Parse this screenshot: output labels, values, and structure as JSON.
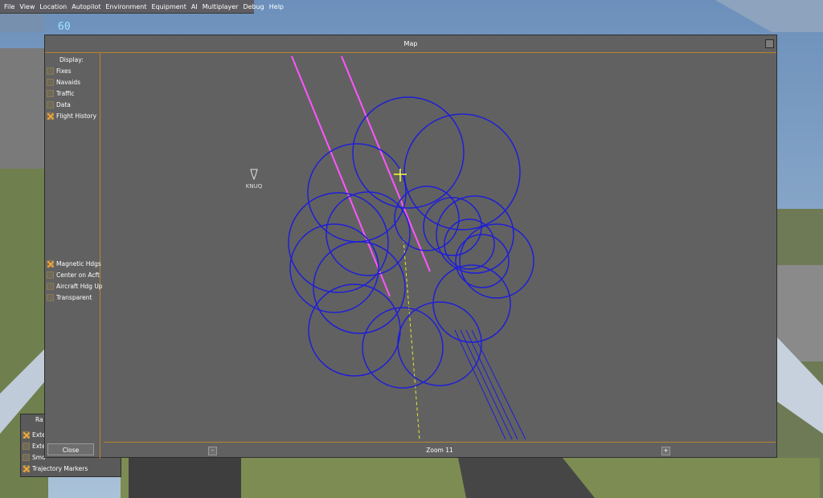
{
  "menubar": {
    "items": [
      "File",
      "View",
      "Location",
      "Autopilot",
      "Environment",
      "Equipment",
      "AI",
      "Multiplayer",
      "Debug",
      "Help"
    ]
  },
  "hud": {
    "speed_value": "60"
  },
  "map_dialog": {
    "title": "Map",
    "display_label": "Display:",
    "display_options": [
      {
        "label": "Fixes",
        "checked": false
      },
      {
        "label": "Navaids",
        "checked": false
      },
      {
        "label": "Traffic",
        "checked": false
      },
      {
        "label": "Data",
        "checked": false
      },
      {
        "label": "Flight History",
        "checked": true
      }
    ],
    "view_options": [
      {
        "label": "Magnetic Hdgs",
        "checked": true
      },
      {
        "label": "Center on Acft",
        "checked": false
      },
      {
        "label": "Aircraft Hdg Up",
        "checked": false
      },
      {
        "label": "Transparent",
        "checked": false
      }
    ],
    "close_label": "Close",
    "zoom_label": "Zoom 11",
    "zoom_out_symbol": "-",
    "zoom_in_symbol": "+",
    "airport_label": "KNUQ"
  },
  "lower_dialog": {
    "title_fragment": "Ra",
    "options": [
      {
        "label": "Exte",
        "checked": true
      },
      {
        "label": "Exte",
        "checked": false
      },
      {
        "label": "Smo",
        "checked": false
      },
      {
        "label": "Trajectory Markers",
        "checked": true
      }
    ]
  },
  "colors": {
    "flight_history": "#1f1fd6",
    "runway": "#ff55ff",
    "aircraft": "#ffff33",
    "accent": "#b9852a"
  }
}
